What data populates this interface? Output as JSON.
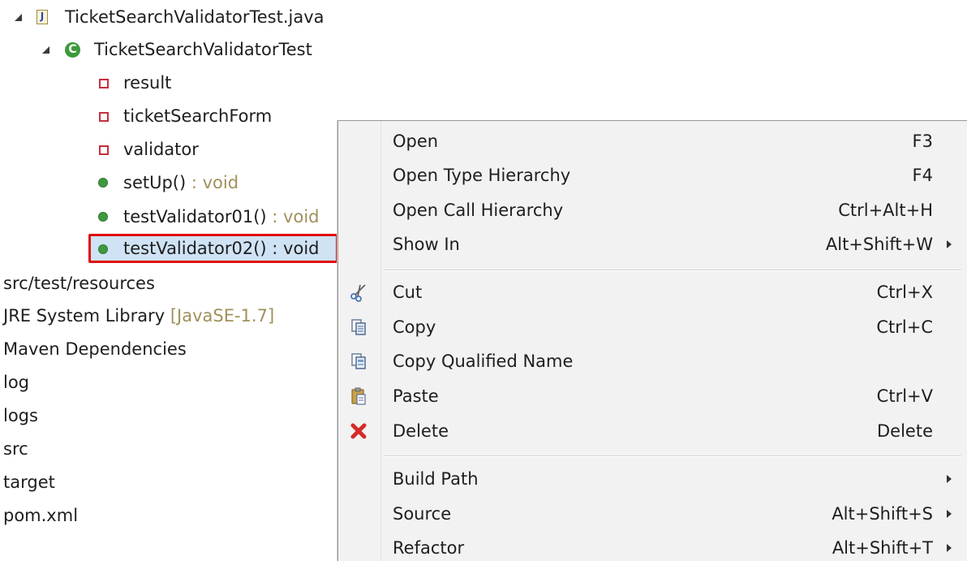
{
  "tree": {
    "items": [
      {
        "label": "TicketSearchValidatorTest.java",
        "icon": "java-file-icon"
      },
      {
        "label": "TicketSearchValidatorTest",
        "icon": "class-icon"
      },
      {
        "label": "result",
        "icon": "field-icon"
      },
      {
        "label": "ticketSearchForm",
        "icon": "field-icon"
      },
      {
        "label": "validator",
        "icon": "field-icon"
      },
      {
        "label": "setUp()",
        "type": " : void",
        "icon": "method-icon"
      },
      {
        "label": "testValidator01()",
        "type": " : void",
        "icon": "method-icon"
      },
      {
        "label": "testValidator02() : void",
        "icon": "method-icon",
        "selected": true
      },
      {
        "label": "src/test/resources"
      },
      {
        "label": "JRE System Library ",
        "type": "[JavaSE-1.7]"
      },
      {
        "label": "Maven Dependencies"
      },
      {
        "label": "log"
      },
      {
        "label": "logs"
      },
      {
        "label": "src"
      },
      {
        "label": "target"
      },
      {
        "label": "pom.xml"
      }
    ],
    "class_icon_glyph": "C",
    "java_icon_glyph": "J"
  },
  "context_menu": {
    "items": [
      {
        "label": "Open",
        "shortcut": "F3"
      },
      {
        "label": "Open Type Hierarchy",
        "shortcut": "F4"
      },
      {
        "label": "Open Call Hierarchy",
        "shortcut": "Ctrl+Alt+H"
      },
      {
        "label": "Show In",
        "shortcut": "Alt+Shift+W",
        "submenu": true
      },
      {
        "label": "Cut",
        "shortcut": "Ctrl+X",
        "icon": "scissors-icon"
      },
      {
        "label": "Copy",
        "shortcut": "Ctrl+C",
        "icon": "copy-icon"
      },
      {
        "label": "Copy Qualified Name",
        "shortcut": "",
        "icon": "copy-qualified-name-icon"
      },
      {
        "label": "Paste",
        "shortcut": "Ctrl+V",
        "icon": "paste-icon"
      },
      {
        "label": "Delete",
        "shortcut": "Delete",
        "icon": "delete-icon"
      },
      {
        "label": "Build Path",
        "shortcut": "",
        "submenu": true
      },
      {
        "label": "Source",
        "shortcut": "Alt+Shift+S",
        "submenu": true
      },
      {
        "label": "Refactor",
        "shortcut": "Alt+Shift+T",
        "submenu": true
      }
    ]
  },
  "colors": {
    "selection_highlight": "#cfe3f5",
    "selection_outline": "#e10d0d",
    "type_annotation": "#a0905a",
    "menu_background": "#f2f2f2"
  }
}
